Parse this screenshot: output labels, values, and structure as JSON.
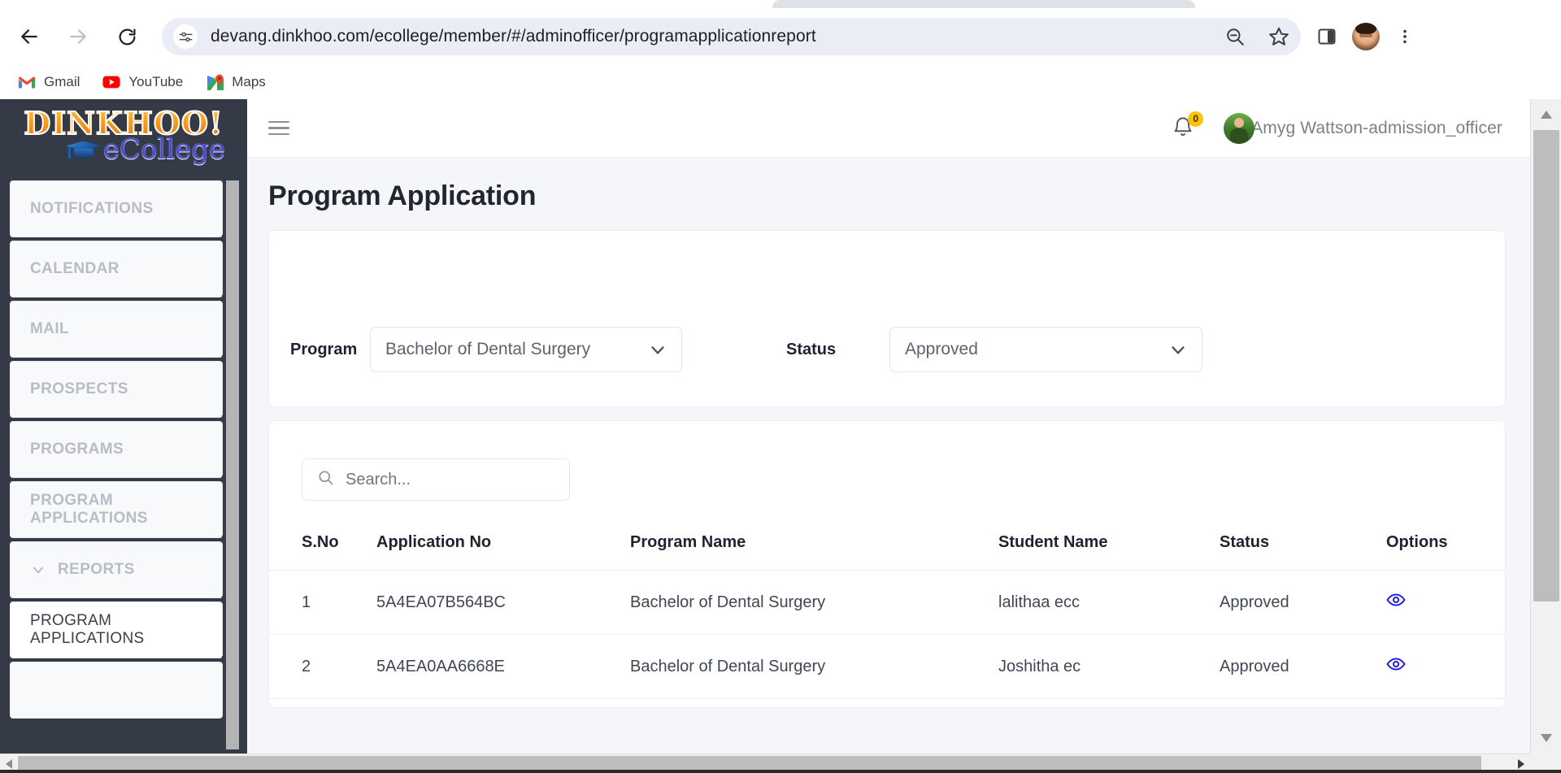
{
  "browser": {
    "url": "devang.dinkhoo.com/ecollege/member/#/adminofficer/programapplicationreport",
    "back_icon": "back-arrow-icon",
    "forward_icon": "forward-arrow-icon",
    "reload_icon": "reload-icon",
    "site_info_icon": "site-settings-icon",
    "zoom_icon": "zoom-out-icon",
    "bookmark_icon": "star-icon",
    "side_panel_icon": "side-panel-icon",
    "profile_icon": "profile-avatar-icon",
    "menu_icon": "three-dot-menu-icon",
    "bookmarks": [
      {
        "label": "Gmail",
        "icon": "gmail-icon"
      },
      {
        "label": "YouTube",
        "icon": "youtube-icon"
      },
      {
        "label": "Maps",
        "icon": "google-maps-icon"
      }
    ]
  },
  "sidebar": {
    "brand": {
      "name": "DINKHOO!",
      "sub": "eCollege"
    },
    "items": [
      {
        "label": "NOTIFICATIONS",
        "expandable": false
      },
      {
        "label": "CALENDAR",
        "expandable": false
      },
      {
        "label": "MAIL",
        "expandable": false
      },
      {
        "label": "PROSPECTS",
        "expandable": false
      },
      {
        "label": "PROGRAMS",
        "expandable": false
      },
      {
        "label": "PROGRAM APPLICATIONS",
        "expandable": false
      },
      {
        "label": "REPORTS",
        "expandable": true
      }
    ],
    "sub_items": [
      {
        "label": "PROGRAM APPLICATIONS"
      }
    ]
  },
  "header": {
    "menu_toggle_icon": "hamburger-menu-icon",
    "notification_icon": "bell-icon",
    "notification_count": "0",
    "user_name": "Amyg Wattson-admission_officer",
    "avatar_icon": "user-avatar"
  },
  "page": {
    "title": "Program Application"
  },
  "filters": {
    "program": {
      "label": "Program",
      "value": "Bachelor of Dental Surgery"
    },
    "status": {
      "label": "Status",
      "value": "Approved"
    },
    "chevron_icon": "chevron-down-icon"
  },
  "search": {
    "placeholder": "Search...",
    "value": "",
    "icon": "search-icon"
  },
  "table": {
    "columns": [
      "S.No",
      "Application No",
      "Program Name",
      "Student Name",
      "Status",
      "Options"
    ],
    "rows": [
      {
        "sno": "1",
        "application_no": "5A4EA07B564BC",
        "program_name": "Bachelor of Dental Surgery",
        "student_name": "lalithaa ecc",
        "status": "Approved",
        "option_icon": "eye-view-icon"
      },
      {
        "sno": "2",
        "application_no": "5A4EA0AA6668E",
        "program_name": "Bachelor of Dental Surgery",
        "student_name": "Joshitha ec",
        "status": "Approved",
        "option_icon": "eye-view-icon"
      }
    ]
  },
  "colors": {
    "sidebar_bg": "#343a46",
    "brand_orange": "#f59a20",
    "brand_blue": "#4b4bd6",
    "badge_yellow": "#ffc107",
    "eye_icon_blue": "#1a1ae0",
    "page_bg": "#f5f6fa"
  }
}
